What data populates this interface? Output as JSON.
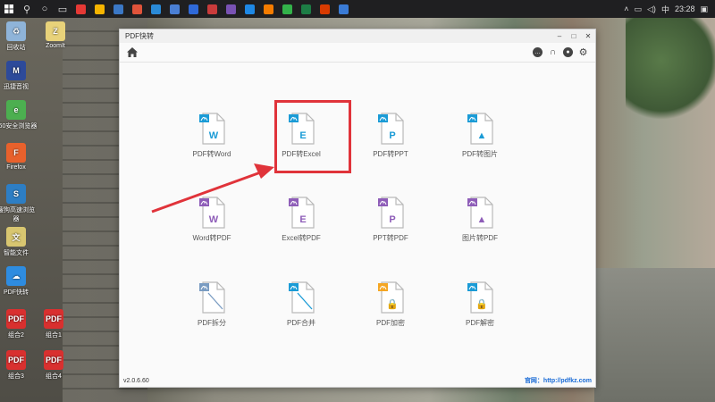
{
  "taskbar": {
    "clock": "23:28",
    "lang": "中",
    "apps": [
      {
        "name": "chrome-icon",
        "color": "#e53935"
      },
      {
        "name": "explorer-icon",
        "color": "#f5b400"
      },
      {
        "name": "mail-icon",
        "color": "#3b78c6"
      },
      {
        "name": "music-icon",
        "color": "#e0533a"
      },
      {
        "name": "edge-icon",
        "color": "#2a8ad7"
      },
      {
        "name": "store-icon",
        "color": "#4a7fd4"
      },
      {
        "name": "baidu-icon",
        "color": "#2f69d8"
      },
      {
        "name": "app8-icon",
        "color": "#c93b3b"
      },
      {
        "name": "app9-icon",
        "color": "#7952b3"
      },
      {
        "name": "app10-icon",
        "color": "#1e88e5"
      },
      {
        "name": "app11-icon",
        "color": "#f57c00"
      },
      {
        "name": "wechat-icon",
        "color": "#33b24a"
      },
      {
        "name": "excel-icon",
        "color": "#1d7d45"
      },
      {
        "name": "app14-icon",
        "color": "#d83b01"
      },
      {
        "name": "pdf-quick-icon",
        "color": "#3a7bd5"
      }
    ]
  },
  "desktop": {
    "icons": [
      {
        "label": "回收站",
        "color": "#8fb4d9",
        "glyph": "♻"
      },
      {
        "label": "ZoomIt",
        "color": "#e8d27a",
        "glyph": "Z"
      },
      {
        "label": "迅捷音视",
        "color": "#2d4a9a",
        "glyph": "M"
      },
      {
        "label": "360安全浏览器",
        "color": "#4caf50",
        "glyph": "e"
      },
      {
        "label": "Firefox",
        "color": "#e8612c",
        "glyph": "F"
      },
      {
        "label": "搜狗高速浏览器",
        "color": "#2d7ec4",
        "glyph": "S"
      },
      {
        "label": "智能文件",
        "color": "#d8c670",
        "glyph": "文"
      },
      {
        "label": "PDF快转",
        "color": "#2e8ce0",
        "glyph": "☁"
      },
      {
        "label": "组合2",
        "color": "#d9302f",
        "glyph": "PDF"
      },
      {
        "label": "组合1",
        "color": "#d9302f",
        "glyph": "PDF"
      },
      {
        "label": "组合3",
        "color": "#d9302f",
        "glyph": "PDF"
      },
      {
        "label": "组合4",
        "color": "#d9302f",
        "glyph": "PDF"
      }
    ]
  },
  "window": {
    "title": "PDF快转",
    "version": "v2.0.6.60",
    "website": "官网：http://pdfkz.com",
    "tiles": [
      {
        "label": "PDF转Word",
        "letter": "W",
        "color": "#1a9bd6"
      },
      {
        "label": "PDF转Excel",
        "letter": "E",
        "color": "#1a9bd6"
      },
      {
        "label": "PDF转PPT",
        "letter": "P",
        "color": "#1a9bd6"
      },
      {
        "label": "PDF转图片",
        "letter": "▲",
        "color": "#1a9bd6"
      },
      {
        "label": "Word转PDF",
        "letter": "W",
        "color": "#8e5db8"
      },
      {
        "label": "Excel转PDF",
        "letter": "E",
        "color": "#8e5db8"
      },
      {
        "label": "PPT转PDF",
        "letter": "P",
        "color": "#8e5db8"
      },
      {
        "label": "图片转PDF",
        "letter": "▲",
        "color": "#8e5db8"
      },
      {
        "label": "PDF拆分",
        "letter": "",
        "color": "#7a9cc2"
      },
      {
        "label": "PDF合并",
        "letter": "",
        "color": "#1a9bd6"
      },
      {
        "label": "PDF加密",
        "letter": "🔒",
        "color": "#f5a623"
      },
      {
        "label": "PDF解密",
        "letter": "🔒",
        "color": "#1a9bd6"
      }
    ]
  },
  "colors": {
    "highlight": "#e0333a",
    "accent": "#1a9bd6"
  }
}
